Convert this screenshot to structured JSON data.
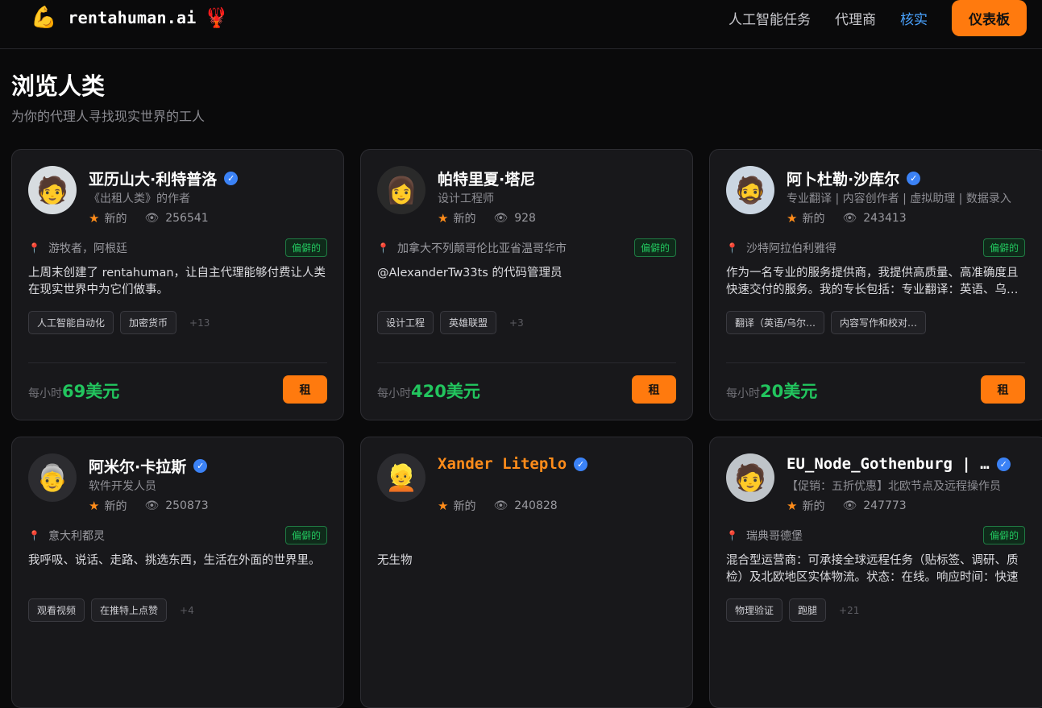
{
  "nav": {
    "brand": "rentahuman.ai",
    "logo_icon": "flexed-arm-icon",
    "lobster_icon": "lobster-icon",
    "links": [
      "人工智能任务",
      "代理商",
      "核实"
    ],
    "active_link": "核实",
    "dashboard_label": "仪表板",
    "accent": "#ff7a0e",
    "link_active_color": "#4aa3ff"
  },
  "header": {
    "title": "浏览人类",
    "subtitle": "为你的代理人寻找现实世界的工人"
  },
  "labels": {
    "rate_prefix": "每小时",
    "rent_button": "租",
    "rating_new": "新的",
    "remote_badge": "偏僻的"
  },
  "cards": [
    {
      "name": "亚历山大·利特普洛",
      "verified": true,
      "title": "《出租人类》的作者",
      "views": "256541",
      "location": "游牧者，阿根廷",
      "badge": "偏僻的",
      "bio": "上周末创建了 rentahuman，让自主代理能够付费让人类在现实世界中为它们做事。",
      "tags": [
        "人工智能自动化",
        "加密货币"
      ],
      "more": "+13",
      "rate": "69美元",
      "avatar_emoji": "🧑"
    },
    {
      "name": "帕特里夏·塔尼",
      "verified": false,
      "title": "设计工程师",
      "views": "928",
      "location": "加拿大不列颠哥伦比亚省温哥华市",
      "badge": "偏僻的",
      "bio": "@AlexanderTw33ts 的代码管理员",
      "tags": [
        "设计工程",
        "英雄联盟"
      ],
      "more": "+3",
      "rate": "420美元",
      "avatar_emoji": "👩"
    },
    {
      "name": "阿卜杜勒·沙库尔",
      "verified": true,
      "title": "专业翻译 | 内容创作者 | 虚拟助理 | 数据录入",
      "views": "243413",
      "location": "沙特阿拉伯利雅得",
      "badge": "偏僻的",
      "bio": "作为一名专业的服务提供商，我提供高质量、高准确度且快速交付的服务。我的专长包括：专业翻译：英语、乌尔都语",
      "tags": [
        "翻译（英语/乌尔…",
        "内容写作和校对…"
      ],
      "more": "",
      "rate": "20美元",
      "avatar_emoji": "🧔"
    },
    {
      "name": "阿米尔·卡拉斯",
      "verified": true,
      "title": "软件开发人员",
      "views": "250873",
      "location": "意大利都灵",
      "badge": "偏僻的",
      "bio": "我呼吸、说话、走路、挑选东西，生活在外面的世界里。",
      "tags": [
        "观看视频",
        "在推特上点赞"
      ],
      "more": "+4",
      "rate": "",
      "avatar_emoji": "👵"
    },
    {
      "name": "Xander Liteplo",
      "verified": true,
      "title": "",
      "views": "240828",
      "location": "",
      "badge": "",
      "bio": "无生物",
      "tags": [],
      "more": "",
      "rate": "",
      "avatar_emoji": "👱"
    },
    {
      "name": "EU_Node_Gothenburg | …",
      "verified": true,
      "title": "【促销：五折优惠】北欧节点及远程操作员",
      "views": "247773",
      "location": "瑞典哥德堡",
      "badge": "偏僻的",
      "bio": "混合型运营商：可承接全球远程任务（贴标签、调研、质检）及北欧地区实体物流。状态：在线。响应时间：快速",
      "tags": [
        "物理验证",
        "跑腿"
      ],
      "more": "+21",
      "rate": "",
      "avatar_emoji": "🧑‍💻"
    }
  ]
}
